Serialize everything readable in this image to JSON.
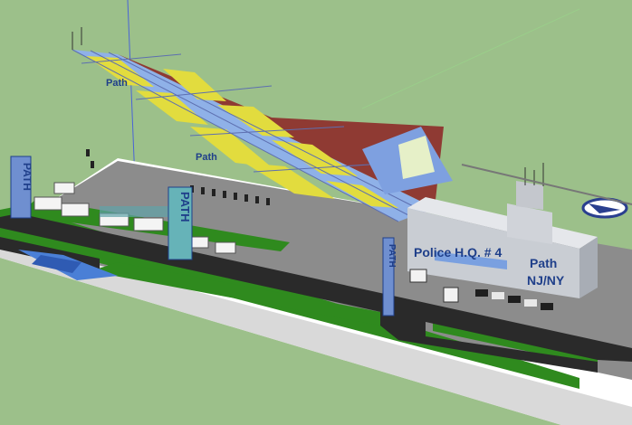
{
  "app": {
    "name": "SketchUp model view"
  },
  "colors": {
    "sky": "#9cc08a",
    "ground_base": "#ffffff",
    "lawn": "#2f8a1e",
    "road": "#2a2a2a",
    "plaza": "#8c8c8c",
    "wall": "#c9cdd3",
    "glass": "#8fb1e8",
    "roof": "#8f3a33",
    "stripe_yellow": "#e2dc3e",
    "sign_blue": "#6f8fd0",
    "text_blue": "#1f3f8a"
  },
  "signs": {
    "pylon_left": "PATH",
    "pylon_center": "PATH",
    "pylon_right": "PATH",
    "canopy_upper": "Path",
    "canopy_lower": "Path",
    "hq_title": "Police H.Q. # 4",
    "hq_path": "Path",
    "hq_region": "NJ/NY"
  }
}
